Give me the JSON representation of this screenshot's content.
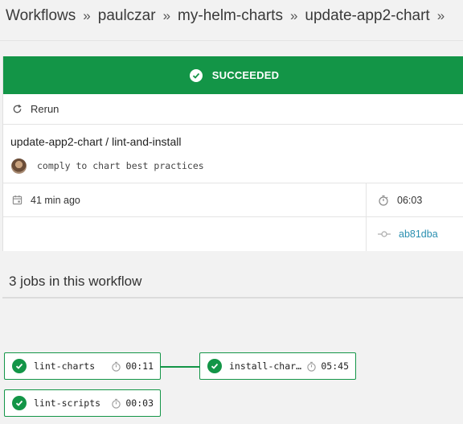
{
  "breadcrumb": [
    "Workflows",
    "paulczar",
    "my-helm-charts",
    "update-app2-chart"
  ],
  "breadcrumb_separator": "»",
  "status": {
    "label": "SUCCEEDED",
    "color": "#139547"
  },
  "actions": {
    "rerun_label": "Rerun"
  },
  "workflow": {
    "title": "update-app2-chart / lint-and-install",
    "commit_message": "comply to chart best practices",
    "started": "41 min ago",
    "duration": "06:03",
    "commit_sha": "ab81dba"
  },
  "jobs_heading": "3 jobs in this workflow",
  "jobs": [
    {
      "name": "lint-charts",
      "duration": "00:11"
    },
    {
      "name": "install-charts",
      "duration": "05:45"
    },
    {
      "name": "lint-scripts",
      "duration": "00:03"
    }
  ],
  "icons": [
    "check-circle-icon",
    "refresh-icon",
    "calendar-icon",
    "stopwatch-icon",
    "git-commit-icon",
    "avatar"
  ]
}
